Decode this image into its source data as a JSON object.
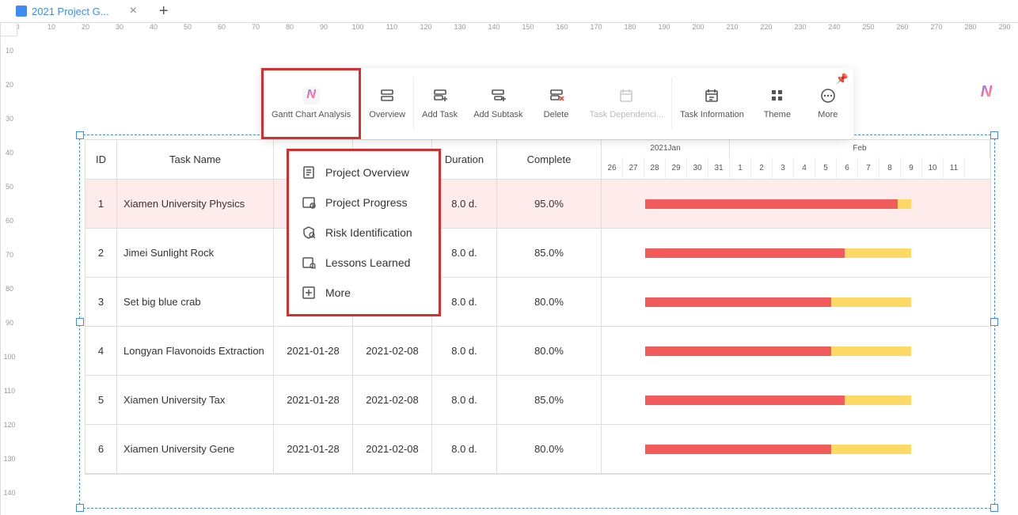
{
  "tab": {
    "title": "2021 Project G..."
  },
  "ruler_h": [
    0,
    10,
    20,
    30,
    40,
    50,
    60,
    70,
    80,
    90,
    100,
    110,
    120,
    130,
    140,
    150,
    160,
    170,
    180,
    190,
    200,
    210,
    220,
    230,
    240,
    250,
    260,
    270,
    280,
    290
  ],
  "ruler_v": [
    10,
    20,
    30,
    40,
    50,
    60,
    70,
    80,
    90,
    100,
    110,
    120,
    130,
    140
  ],
  "toolbar": {
    "gantt_analysis": "Gantt Chart Analysis",
    "overview": "Overview",
    "add_task": "Add Task",
    "add_subtask": "Add Subtask",
    "delete": "Delete",
    "task_dep": "Task Dependenci...",
    "task_info": "Task Information",
    "theme": "Theme",
    "more": "More"
  },
  "dropdown": {
    "project_overview": "Project Overview",
    "project_progress": "Project Progress",
    "risk_identification": "Risk Identification",
    "lessons_learned": "Lessons Learned",
    "more": "More"
  },
  "table": {
    "headers": {
      "id": "ID",
      "task": "Task Name",
      "duration": "Duration",
      "complete": "Complete"
    },
    "months": [
      "2021Jan",
      "Feb"
    ],
    "days": [
      26,
      27,
      28,
      29,
      30,
      31,
      1,
      2,
      3,
      4,
      5,
      6,
      7,
      8,
      9,
      10,
      11
    ],
    "rows": [
      {
        "id": "1",
        "task": "Xiamen University Physics",
        "start": "",
        "end": "",
        "duration": "8.0 d.",
        "complete": "95.0%",
        "progress_pct": 95
      },
      {
        "id": "2",
        "task": "Jimei Sunlight Rock",
        "start": "",
        "end": "",
        "duration": "8.0 d.",
        "complete": "85.0%",
        "progress_pct": 75
      },
      {
        "id": "3",
        "task": "Set big blue crab",
        "start": "",
        "end": "",
        "duration": "8.0 d.",
        "complete": "80.0%",
        "progress_pct": 70
      },
      {
        "id": "4",
        "task": "Longyan Flavonoids Extraction",
        "start": "2021-01-28",
        "end": "2021-02-08",
        "duration": "8.0 d.",
        "complete": "80.0%",
        "progress_pct": 70
      },
      {
        "id": "5",
        "task": "Xiamen University Tax",
        "start": "2021-01-28",
        "end": "2021-02-08",
        "duration": "8.0 d.",
        "complete": "85.0%",
        "progress_pct": 75
      },
      {
        "id": "6",
        "task": "Xiamen University Gene",
        "start": "2021-01-28",
        "end": "2021-02-08",
        "duration": "8.0 d.",
        "complete": "80.0%",
        "progress_pct": 70
      }
    ]
  }
}
